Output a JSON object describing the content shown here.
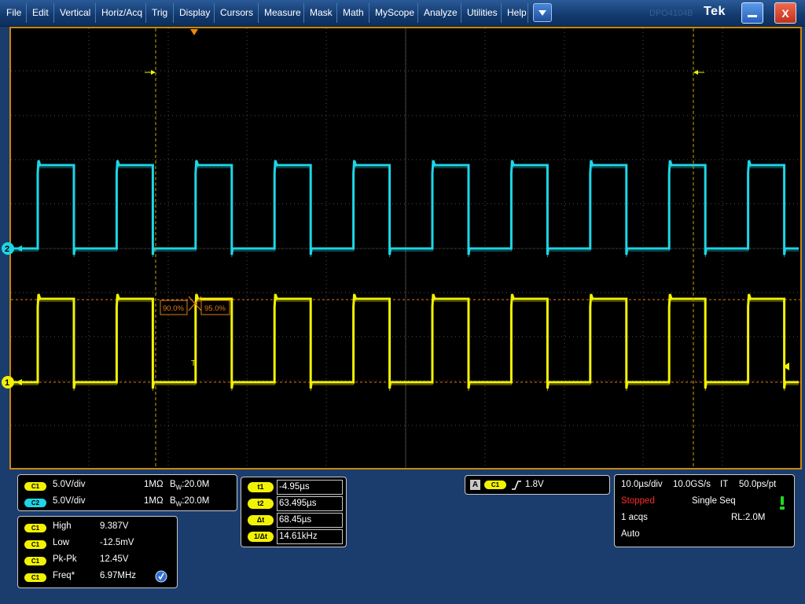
{
  "menu": {
    "items": [
      "File",
      "Edit",
      "Vertical",
      "Horiz/Acq",
      "Trig",
      "Display",
      "Cursors",
      "Measure",
      "Mask",
      "Math",
      "MyScope",
      "Analyze",
      "Utilities",
      "Help"
    ],
    "dropdown_icon": "chevron-down-icon"
  },
  "window": {
    "brand_ghost": "DPO4104B",
    "brand": "Tek",
    "minimize_icon": "minimize-icon",
    "close_label": "X"
  },
  "display": {
    "colors": {
      "ch1": "#f2f204",
      "ch2": "#1ed6e6",
      "cursor": "#c8a200",
      "ref": "#e07a16",
      "grid": "#5a5a5a",
      "frame": "#c8870a"
    },
    "ch1_marker": "1",
    "ch2_marker": "2",
    "trigger_marker": "T",
    "ref_left_label": "90.0%",
    "ref_right_label": "95.0%"
  },
  "channels": [
    {
      "pill": "C1",
      "scale": "5.0V/div",
      "impedance": "1MΩ",
      "bw_prefix": "B",
      "bw_sub": "W",
      "bw_value": ":20.0M"
    },
    {
      "pill": "C2",
      "scale": "5.0V/div",
      "impedance": "1MΩ",
      "bw_prefix": "B",
      "bw_sub": "W",
      "bw_value": ":20.0M"
    }
  ],
  "measurements": [
    {
      "pill": "C1",
      "name": "High",
      "value": "9.387V"
    },
    {
      "pill": "C1",
      "name": "Low",
      "value": "-12.5mV"
    },
    {
      "pill": "C1",
      "name": "Pk-Pk",
      "value": "12.45V"
    },
    {
      "pill": "C1",
      "name": "Freq*",
      "value": "6.97MHz"
    }
  ],
  "cursors": [
    {
      "label": "t1",
      "value": "-4.95µs"
    },
    {
      "label": "t2",
      "value": "63.495µs"
    },
    {
      "label": "Δt",
      "value": "68.45µs"
    },
    {
      "label": "1/Δt",
      "value": "14.61kHz"
    }
  ],
  "trigger": {
    "mode": "A",
    "source": "C1",
    "level": "1.8V"
  },
  "acquisition": {
    "timebase": "10.0µs/div",
    "sample_rate": "10.0GS/s",
    "mode": "IT",
    "resolution": "50.0ps/pt",
    "status": "Stopped",
    "sequence": "Single Seq",
    "acqs": "1 acqs",
    "record_length": "RL:2.0M",
    "trigger_mode": "Auto"
  }
}
